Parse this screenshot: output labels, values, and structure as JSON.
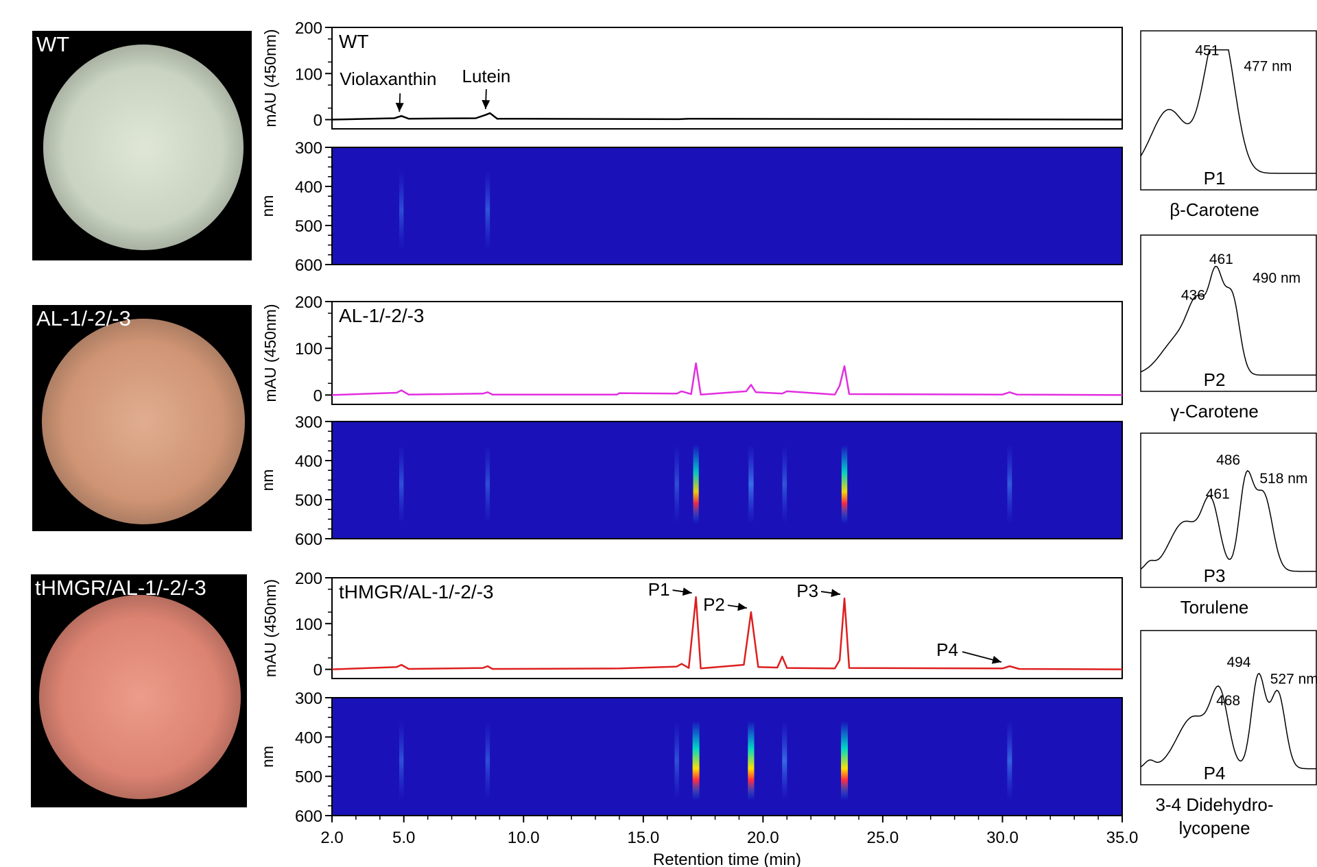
{
  "samples": [
    {
      "label": "WT",
      "trace_color": "#000000",
      "dish_color": "#c9d3c0"
    },
    {
      "label": "AL-1/-2/-3",
      "trace_color": "#e22ee0",
      "dish_color": "#d49a7c"
    },
    {
      "label": "tHMGR/AL-1/-2/-3",
      "trace_color": "#dd1e1e",
      "dish_color": "#e2897a"
    }
  ],
  "chart_data": [
    {
      "type": "line",
      "panel": "WT",
      "title": "WT",
      "ylabel": "mAU (450nm)",
      "ylim": [
        0,
        200
      ],
      "yticks": [
        "200",
        "100",
        "0"
      ],
      "series": [
        {
          "x": [
            2,
            4.6,
            4.9,
            5.2,
            8.0,
            8.4,
            8.6,
            8.9,
            16.5,
            16.9,
            35
          ],
          "y": [
            0,
            3,
            8,
            2,
            3,
            10,
            14,
            2,
            1,
            2,
            0
          ]
        }
      ],
      "annotations": [
        {
          "text": "Violaxanthin",
          "x": 4.9,
          "y": 8
        },
        {
          "text": "Lutein",
          "x": 8.5,
          "y": 14
        }
      ]
    },
    {
      "type": "heatmap",
      "panel": "WT",
      "ylabel": "nm",
      "ylim": [
        300,
        600
      ],
      "yticks": [
        "300",
        "400",
        "500",
        "600"
      ],
      "bands": [
        {
          "x": 4.9,
          "intensity": 0.1
        },
        {
          "x": 8.5,
          "intensity": 0.15
        }
      ]
    },
    {
      "type": "line",
      "panel": "AL-1/-2/-3",
      "title": "AL-1/-2/-3",
      "ylabel": "mAU (450nm)",
      "ylim": [
        0,
        200
      ],
      "yticks": [
        "200",
        "100",
        "0"
      ],
      "series": [
        {
          "x": [
            2,
            4.7,
            4.9,
            5.2,
            8.3,
            8.5,
            8.7,
            13.9,
            14.0,
            16.4,
            16.6,
            17.0,
            17.2,
            17.4,
            19.3,
            19.5,
            19.7,
            20.8,
            21.0,
            23.0,
            23.2,
            23.4,
            23.6,
            30.0,
            30.3,
            30.6,
            35
          ],
          "y": [
            0,
            5,
            10,
            1,
            3,
            6,
            1,
            1,
            4,
            3,
            8,
            2,
            68,
            1,
            8,
            22,
            6,
            3,
            8,
            1,
            20,
            62,
            2,
            1,
            6,
            1,
            0
          ]
        }
      ]
    },
    {
      "type": "heatmap",
      "panel": "AL-1/-2/-3",
      "ylabel": "nm",
      "ylim": [
        300,
        600
      ],
      "yticks": [
        "300",
        "400",
        "500",
        "600"
      ],
      "bands": [
        {
          "x": 4.9,
          "intensity": 0.12
        },
        {
          "x": 8.5,
          "intensity": 0.1
        },
        {
          "x": 16.4,
          "intensity": 0.1
        },
        {
          "x": 17.2,
          "intensity": 0.55
        },
        {
          "x": 19.5,
          "intensity": 0.35
        },
        {
          "x": 20.9,
          "intensity": 0.15
        },
        {
          "x": 23.4,
          "intensity": 0.6
        },
        {
          "x": 30.3,
          "intensity": 0.2
        }
      ]
    },
    {
      "type": "line",
      "panel": "tHMGR/AL-1/-2/-3",
      "title": "tHMGR/AL-1/-2/-3",
      "ylabel": "mAU (450nm)",
      "ylim": [
        0,
        200
      ],
      "yticks": [
        "200",
        "100",
        "0"
      ],
      "series": [
        {
          "x": [
            2,
            4.7,
            4.9,
            5.2,
            8.3,
            8.5,
            8.7,
            14.0,
            16.4,
            16.6,
            16.9,
            17.2,
            17.4,
            19.2,
            19.5,
            19.8,
            20.6,
            20.8,
            21.0,
            23.0,
            23.2,
            23.4,
            23.6,
            30.0,
            30.3,
            30.7,
            35
          ],
          "y": [
            0,
            5,
            10,
            1,
            3,
            7,
            1,
            2,
            6,
            12,
            3,
            158,
            2,
            10,
            125,
            5,
            4,
            28,
            3,
            2,
            20,
            155,
            3,
            2,
            7,
            1,
            0
          ]
        }
      ],
      "annotations": [
        {
          "text": "P1",
          "x": 17.2,
          "y": 158
        },
        {
          "text": "P2",
          "x": 19.5,
          "y": 125
        },
        {
          "text": "P3",
          "x": 23.4,
          "y": 155
        },
        {
          "text": "P4",
          "x": 30.3,
          "y": 7
        }
      ]
    },
    {
      "type": "heatmap",
      "panel": "tHMGR/AL-1/-2/-3",
      "ylabel": "nm",
      "ylim": [
        300,
        600
      ],
      "yticks": [
        "300",
        "400",
        "500",
        "600"
      ],
      "xlabel": "Retention time (min)",
      "xlim": [
        2.0,
        35.0
      ],
      "xticks": [
        "2.0",
        "5.0",
        "10.0",
        "15.0",
        "20.0",
        "25.0",
        "30.0",
        "35.0"
      ],
      "bands": [
        {
          "x": 4.9,
          "intensity": 0.12
        },
        {
          "x": 8.5,
          "intensity": 0.1
        },
        {
          "x": 16.4,
          "intensity": 0.12
        },
        {
          "x": 17.2,
          "intensity": 1.0
        },
        {
          "x": 19.5,
          "intensity": 0.8
        },
        {
          "x": 20.9,
          "intensity": 0.3
        },
        {
          "x": 23.4,
          "intensity": 1.0
        },
        {
          "x": 30.3,
          "intensity": 0.25
        }
      ]
    },
    {
      "type": "line",
      "panel": "spectrum",
      "peak_label": "P1",
      "compound": "β-Carotene",
      "maxima": [
        "451",
        "477 nm"
      ]
    },
    {
      "type": "line",
      "panel": "spectrum",
      "peak_label": "P2",
      "compound": "γ-Carotene",
      "maxima": [
        "436",
        "461",
        "490 nm"
      ]
    },
    {
      "type": "line",
      "panel": "spectrum",
      "peak_label": "P3",
      "compound": "Torulene",
      "maxima": [
        "461",
        "486",
        "518 nm"
      ]
    },
    {
      "type": "line",
      "panel": "spectrum",
      "peak_label": "P4",
      "compound": "3-4 Didehydro- lycopene",
      "compound_lines": [
        "3-4 Didehydro-",
        "lycopene"
      ],
      "maxima": [
        "468",
        "494",
        "527 nm"
      ]
    }
  ]
}
